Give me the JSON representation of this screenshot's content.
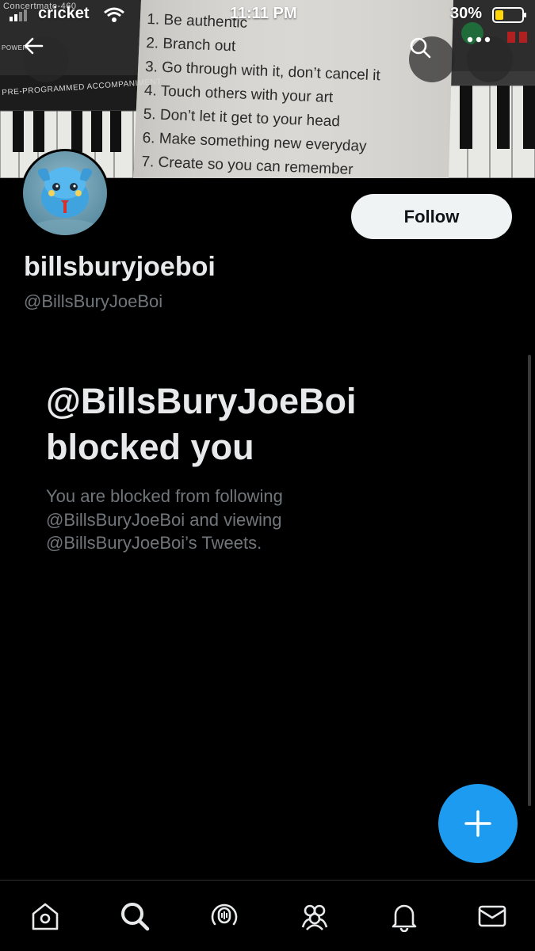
{
  "status_bar": {
    "carrier": "cricket",
    "time": "11:11 PM",
    "battery": "30%"
  },
  "banner": {
    "keyboard_model": "Concertmate-460",
    "keyboard_label": "PRE-PROGRAMMED ACCOMPANIMENT",
    "keyboard_power": "POWER",
    "note_items": [
      "1.  Be authentic",
      "2.  Branch out",
      "3.  Go through with it, don’t cancel it",
      "4.  Touch others with your art",
      "5.  Don’t let it get to your head",
      "6.  Make something new everyday",
      "7.  Create so you can remember"
    ]
  },
  "profile": {
    "display_name": "billsburyjoeboi",
    "handle": "@BillsBuryJoeBoi",
    "follow_label": "Follow"
  },
  "blocked": {
    "title_line1": "@BillsBuryJoeBoi",
    "title_line2": "blocked you",
    "description": "You are blocked from following @BillsBuryJoeBoi and viewing @BillsBuryJoeBoi’s Tweets."
  },
  "nav": {
    "items": [
      {
        "name": "home",
        "icon": "home-icon"
      },
      {
        "name": "search",
        "icon": "search-icon"
      },
      {
        "name": "spaces",
        "icon": "spaces-icon"
      },
      {
        "name": "communities",
        "icon": "communities-icon"
      },
      {
        "name": "notifications",
        "icon": "bell-icon"
      },
      {
        "name": "messages",
        "icon": "mail-icon"
      }
    ]
  },
  "colors": {
    "accent": "#1d9bf0",
    "background": "#000000",
    "secondary_text": "#71767b",
    "follow_button": "#eff3f4"
  }
}
